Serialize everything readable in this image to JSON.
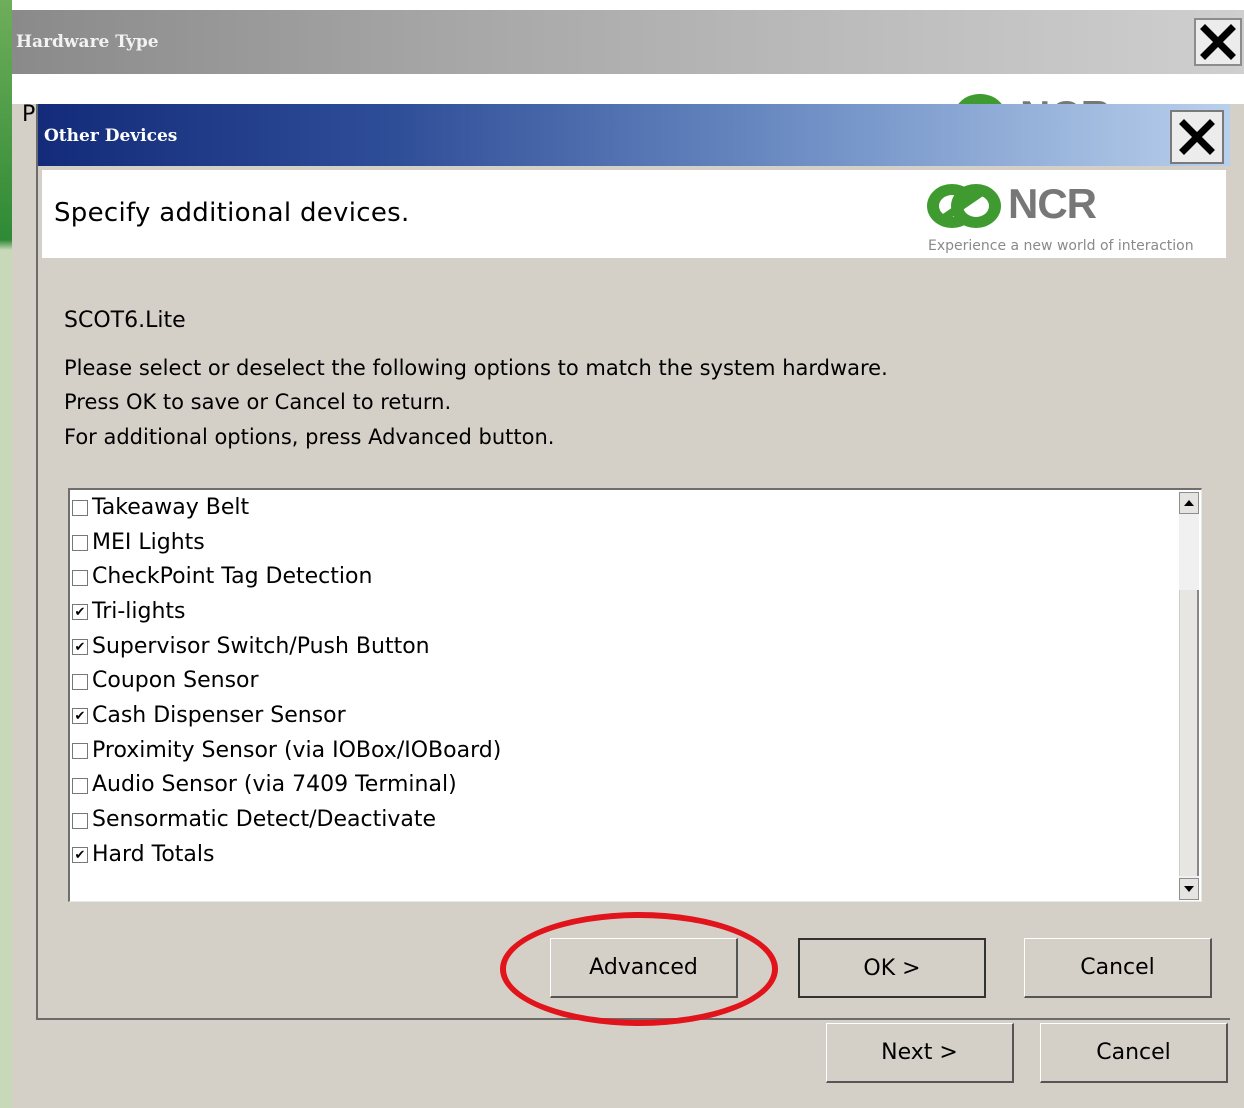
{
  "parent": {
    "title": "Hardware Type",
    "partial_label": "P",
    "close_label": "X",
    "buttons": {
      "next": "Next >",
      "cancel": "Cancel"
    }
  },
  "dialog": {
    "title": "Other Devices",
    "close_label": "X",
    "header_text": "Specify additional devices.",
    "logo": {
      "name": "NCR",
      "tagline": "Experience a new world of interaction"
    },
    "model": "SCOT6.Lite",
    "instructions": [
      "Please select or deselect the following options to match the system hardware.",
      "Press OK to save or Cancel to return.",
      "For additional options, press Advanced button."
    ],
    "options": [
      {
        "label": "Takeaway Belt",
        "checked": false
      },
      {
        "label": "MEI Lights",
        "checked": false
      },
      {
        "label": "CheckPoint Tag Detection",
        "checked": false
      },
      {
        "label": "Tri-lights",
        "checked": true
      },
      {
        "label": "Supervisor Switch/Push Button",
        "checked": true
      },
      {
        "label": "Coupon Sensor",
        "checked": false
      },
      {
        "label": "Cash Dispenser Sensor",
        "checked": true
      },
      {
        "label": "Proximity Sensor (via IOBox/IOBoard)",
        "checked": false
      },
      {
        "label": "Audio Sensor (via 7409 Terminal)",
        "checked": false
      },
      {
        "label": "Sensormatic Detect/Deactivate",
        "checked": false
      },
      {
        "label": "Hard Totals",
        "checked": true
      }
    ],
    "buttons": {
      "advanced": "Advanced",
      "ok": "OK >",
      "cancel": "Cancel"
    }
  },
  "colors": {
    "highlight": "#e0141a",
    "title_gradient_start": "#132b7a",
    "dialog_bg": "#d5d0c7"
  },
  "icons": {
    "close": "close-icon",
    "scroll_up": "scroll-up-arrow-icon",
    "scroll_down": "scroll-down-arrow-icon",
    "logo": "ncr-logo-icon"
  }
}
